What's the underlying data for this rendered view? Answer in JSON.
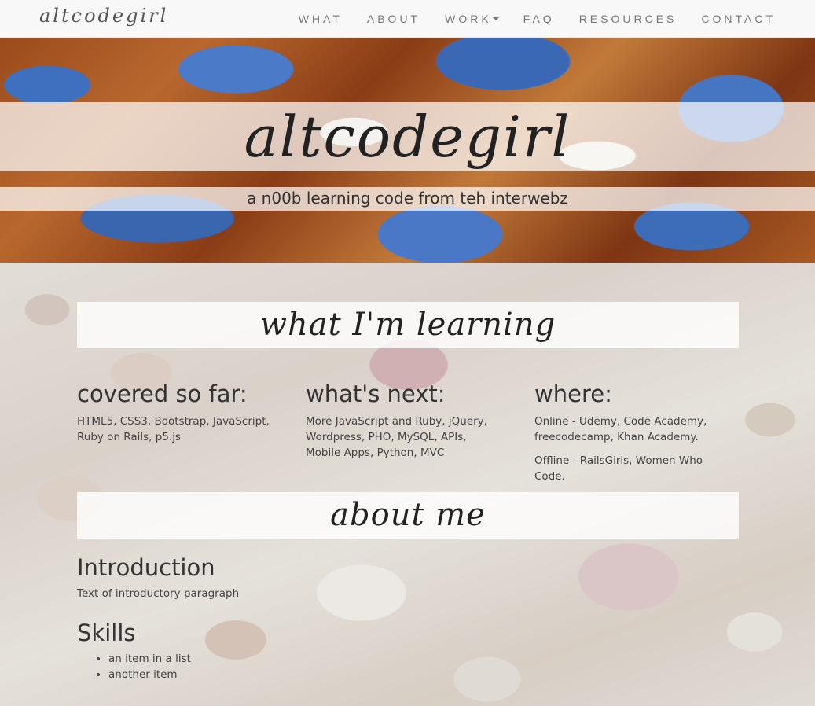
{
  "brand": "altcodegirl",
  "nav": {
    "items": [
      "WHAT",
      "ABOUT",
      "WORK",
      "FAQ",
      "RESOURCES",
      "CONTACT"
    ]
  },
  "hero": {
    "title": "altcodegirl",
    "subtitle": "a n00b learning code from teh interwebz"
  },
  "learning": {
    "heading": "what I'm learning",
    "columns": [
      {
        "title": "covered so far:",
        "paragraphs": [
          "HTML5, CSS3, Bootstrap, JavaScript, Ruby on Rails, p5.js"
        ]
      },
      {
        "title": "what's next:",
        "paragraphs": [
          "More JavaScript and Ruby, jQuery, Wordpress, PHO, MySQL, APIs, Mobile Apps, Python, MVC"
        ]
      },
      {
        "title": "where:",
        "paragraphs": [
          "Online - Udemy, Code Academy, freecodecamp, Khan Academy.",
          "Offline - RailsGirls, Women Who Code."
        ]
      }
    ]
  },
  "about": {
    "heading": "about me",
    "intro_title": "Introduction",
    "intro_text": "Text of introductory paragraph",
    "skills_title": "Skills",
    "skills": [
      "an item in a list",
      "another item"
    ]
  }
}
